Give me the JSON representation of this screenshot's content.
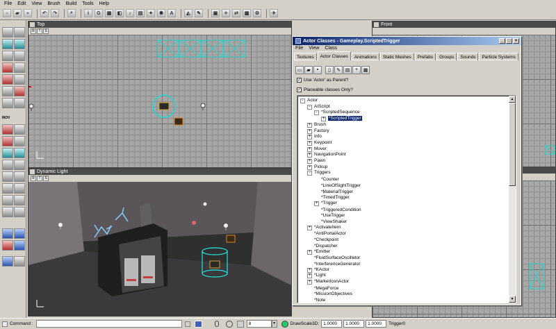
{
  "menu": [
    "File",
    "Edit",
    "View",
    "Brush",
    "Build",
    "Tools",
    "Help"
  ],
  "viewports": {
    "top": {
      "title": "Top",
      "bar": [
        "R",
        "T",
        "S"
      ]
    },
    "front": {
      "title": "Front"
    },
    "dynamic": {
      "title": "Dynamic Light",
      "bar": [
        "R",
        "T",
        "S"
      ]
    }
  },
  "left_toolbar": {
    "mov_label": "MOV"
  },
  "dialog": {
    "title": "Actor Classes - Gameplay.ScriptedTrigger",
    "menu": [
      "File",
      "View",
      "Class"
    ],
    "tabs": [
      "Textures",
      "Actor Classes",
      "Animations",
      "Static Meshes",
      "Prefabs",
      "Groups",
      "Sounds",
      "Particle Systems"
    ],
    "active_tab": "Actor Classes",
    "use_actor_label": "Use 'Actor' as Parent?",
    "placeable_label": "Placeable classes Only?",
    "tree": [
      {
        "label": "Actor",
        "depth": 0,
        "box": "-"
      },
      {
        "label": "AIScript",
        "depth": 1,
        "box": "-"
      },
      {
        "label": "*ScriptedSequence",
        "depth": 2,
        "box": "-"
      },
      {
        "label": "*ScriptedTrigger",
        "depth": 3,
        "box": "+",
        "selected": true
      },
      {
        "label": "Brush",
        "depth": 1,
        "box": "+"
      },
      {
        "label": "Factory",
        "depth": 1,
        "box": "+"
      },
      {
        "label": "Info",
        "depth": 1,
        "box": "+"
      },
      {
        "label": "Keypoint",
        "depth": 1,
        "box": "+"
      },
      {
        "label": "Mover",
        "depth": 1,
        "box": "+"
      },
      {
        "label": "NavigationPoint",
        "depth": 1,
        "box": "+"
      },
      {
        "label": "Pawn",
        "depth": 1,
        "box": "+"
      },
      {
        "label": "Pickup",
        "depth": 1,
        "box": "+"
      },
      {
        "label": "Triggers",
        "depth": 1,
        "box": "-"
      },
      {
        "label": "*Counter",
        "depth": 2,
        "box": ""
      },
      {
        "label": "*LineOfSightTrigger",
        "depth": 2,
        "box": ""
      },
      {
        "label": "*MaterialTrigger",
        "depth": 2,
        "box": ""
      },
      {
        "label": "*TimedTrigger",
        "depth": 2,
        "box": ""
      },
      {
        "label": "*Trigger",
        "depth": 2,
        "box": "+"
      },
      {
        "label": "*TriggeredCondition",
        "depth": 2,
        "box": ""
      },
      {
        "label": "*UseTrigger",
        "depth": 2,
        "box": ""
      },
      {
        "label": "*ViewShaker",
        "depth": 2,
        "box": ""
      },
      {
        "label": "*ActivateItem",
        "depth": 1,
        "box": "+"
      },
      {
        "label": "*AntiPortalActor",
        "depth": 1,
        "box": ""
      },
      {
        "label": "*Checkpoint",
        "depth": 1,
        "box": ""
      },
      {
        "label": "*Dispatcher",
        "depth": 1,
        "box": ""
      },
      {
        "label": "*Emitter",
        "depth": 1,
        "box": "+"
      },
      {
        "label": "*FluidSurfaceOscillator",
        "depth": 1,
        "box": ""
      },
      {
        "label": "*InterferenceGenerator",
        "depth": 1,
        "box": ""
      },
      {
        "label": "*KActor",
        "depth": 1,
        "box": "+"
      },
      {
        "label": "*Light",
        "depth": 1,
        "box": "+"
      },
      {
        "label": "*MarkerIconActor",
        "depth": 1,
        "box": "+"
      },
      {
        "label": "*MegaForce",
        "depth": 1,
        "box": ""
      },
      {
        "label": "*MissionObjectives",
        "depth": 1,
        "box": ""
      },
      {
        "label": "*Note",
        "depth": 1,
        "box": ""
      }
    ]
  },
  "status": {
    "command_label": "Command :",
    "grid_value": "8",
    "drawscale_label": "DrawScale3D:",
    "scale_x": "1.0000",
    "scale_y": "1.0000",
    "scale_z": "1.0000",
    "selected_actor": "Trigger0"
  }
}
